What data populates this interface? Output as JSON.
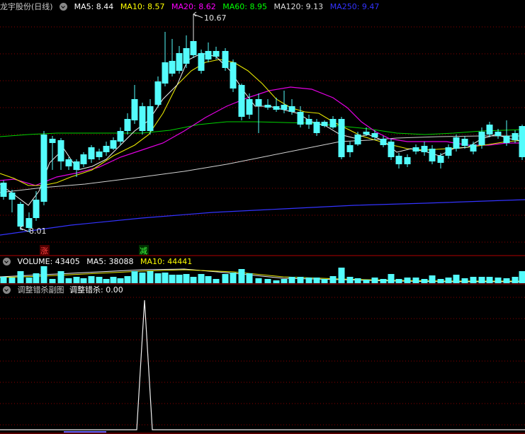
{
  "main_panel": {
    "title": "龙宇股份(日线)",
    "indicators": [
      {
        "label": "MA5: 8.44",
        "color": "#ffffff"
      },
      {
        "label": "MA10: 8.57",
        "color": "#ffff00"
      },
      {
        "label": "MA20: 8.62",
        "color": "#ff00ff"
      },
      {
        "label": "MA60: 8.95",
        "color": "#00ff00"
      },
      {
        "label": "MA120: 9.13",
        "color": "#dddddd"
      },
      {
        "label": "MA250: 9.47",
        "color": "#3333ff"
      }
    ],
    "high_label": "10.67",
    "low_label": "8.01",
    "badge_up": "涨",
    "badge_down": "减"
  },
  "volume_panel": {
    "indicators": [
      {
        "label": "VOLUME: 43405",
        "color": "#ffffff"
      },
      {
        "label": "MA5: 38088",
        "color": "#ffffff"
      },
      {
        "label": "MA10: 44441",
        "color": "#ffff00"
      }
    ]
  },
  "sub_panel": {
    "title": "调整错杀副图",
    "indicators": [
      {
        "label": "调整错杀: 0.00",
        "color": "#ffffff"
      }
    ]
  },
  "colors": {
    "up": "#ff3232",
    "down": "#54fcfc",
    "grid": "#8b0000",
    "separator": "#b00000"
  }
}
